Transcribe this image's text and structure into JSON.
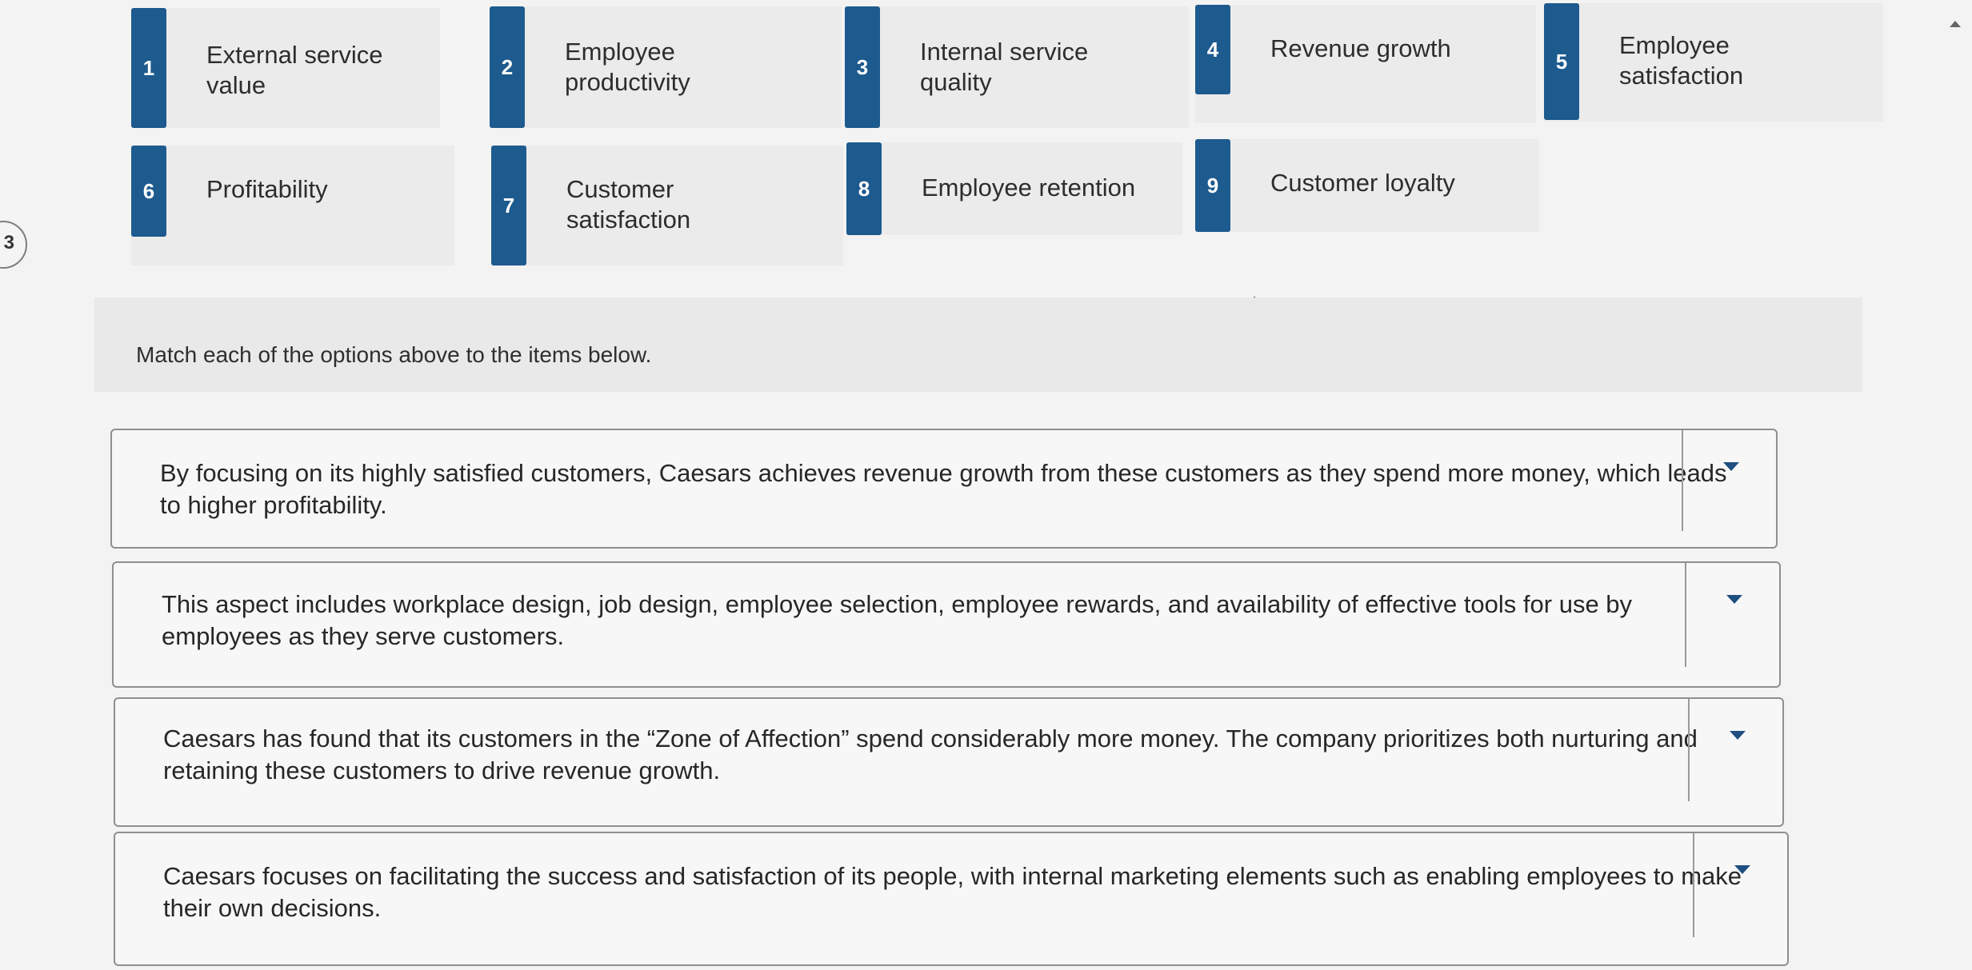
{
  "options": [
    {
      "num": "1",
      "label": "External service value"
    },
    {
      "num": "2",
      "label": "Employee productivity"
    },
    {
      "num": "3",
      "label": "Internal service quality"
    },
    {
      "num": "4",
      "label": "Revenue growth"
    },
    {
      "num": "5",
      "label": "Employee satisfaction"
    },
    {
      "num": "6",
      "label": "Profitability"
    },
    {
      "num": "7",
      "label": "Customer satisfaction"
    },
    {
      "num": "8",
      "label": "Employee retention"
    },
    {
      "num": "9",
      "label": "Customer loyalty"
    }
  ],
  "question_number": "3",
  "instruction": "Match each of the options above to the items below.",
  "items": [
    {
      "text": "By focusing on its highly satisfied customers, Caesars achieves revenue growth from these customers as they spend more money, which leads to higher profitability.",
      "selected": ""
    },
    {
      "text": "This aspect includes workplace design, job design, employee selection, employee rewards, and availability of effective tools for use by employees as they serve customers.",
      "selected": ""
    },
    {
      "text": "Caesars has found that its customers in the “Zone of Affection” spend considerably more money. The company prioritizes both nurturing and retaining these customers to drive revenue growth.",
      "selected": ""
    },
    {
      "text": "Caesars focuses on facilitating the success and satisfaction of its people, with internal marketing elements such as enabling employees to make their own decisions.",
      "selected": ""
    }
  ],
  "colors": {
    "badge": "#1d5a8e",
    "dropdown_arrow": "#1f4f80"
  },
  "icons": {
    "dropdown": "caret-down-icon",
    "pointer": "mouse-pointer-icon",
    "scroll": "scroll-up-icon"
  }
}
